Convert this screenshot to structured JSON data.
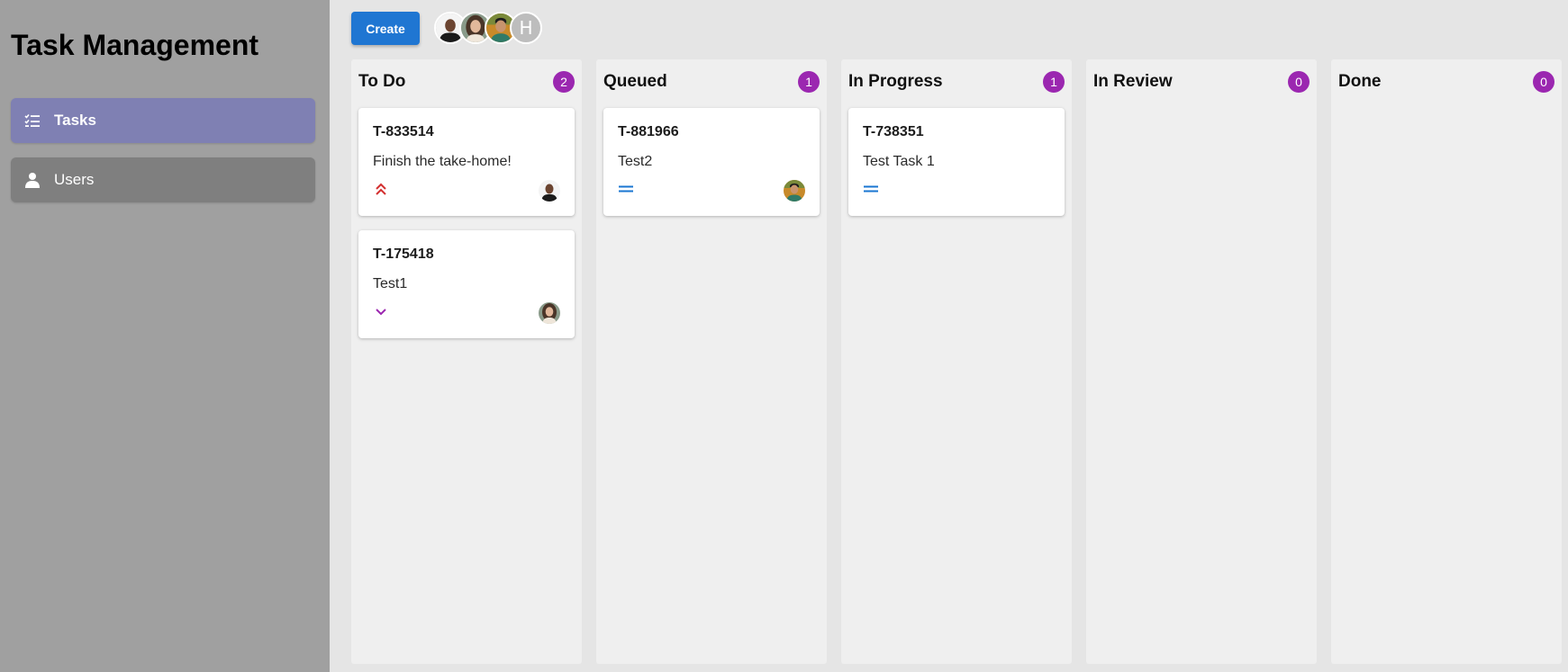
{
  "app": {
    "title": "Task Management"
  },
  "sidebar": {
    "items": [
      {
        "label": "Tasks",
        "icon": "checklist-icon",
        "active": true
      },
      {
        "label": "Users",
        "icon": "person-icon",
        "active": false
      }
    ]
  },
  "toolbar": {
    "create_label": "Create",
    "avatars": [
      {
        "name": "user-avatar-1"
      },
      {
        "name": "user-avatar-2"
      },
      {
        "name": "user-avatar-3"
      },
      {
        "letter": "H"
      }
    ]
  },
  "columns": [
    {
      "title": "To Do",
      "count": "2",
      "cards": [
        {
          "id": "T-833514",
          "title": "Finish the take-home!",
          "priority": "highest",
          "priority_color": "#d32f2f"
        },
        {
          "id": "T-175418",
          "title": "Test1",
          "priority": "low",
          "priority_color": "#9c27b0"
        }
      ]
    },
    {
      "title": "Queued",
      "count": "1",
      "cards": [
        {
          "id": "T-881966",
          "title": "Test2",
          "priority": "medium",
          "priority_color": "#1976d2"
        }
      ]
    },
    {
      "title": "In Progress",
      "count": "1",
      "cards": [
        {
          "id": "T-738351",
          "title": "Test Task 1",
          "priority": "medium",
          "priority_color": "#1976d2"
        }
      ]
    },
    {
      "title": "In Review",
      "count": "0",
      "cards": []
    },
    {
      "title": "Done",
      "count": "0",
      "cards": []
    }
  ],
  "colors": {
    "sidebar_bg": "#a0a0a0",
    "active_nav": "#7f80b3",
    "inactive_nav": "#7f7f7f",
    "accent": "#1f76d2",
    "badge": "#9b27b0"
  }
}
